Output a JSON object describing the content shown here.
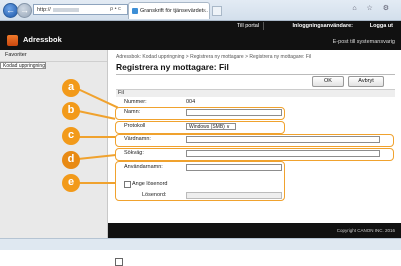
{
  "browser": {
    "address_prefix": "http://",
    "address_controls": "ρ • c",
    "tab_title": "Granskrift för tjänsevärdet...",
    "tab_close": "×",
    "window_controls": "⌂ ☆ ⚙"
  },
  "appbar": {
    "app_name": "Adressbok",
    "links": [
      "Till portal",
      "Inloggningsanvändare:",
      "Logga ut"
    ],
    "email_link": "E-post till systemansvarig"
  },
  "sidebar": {
    "items": [
      {
        "label": "Favoriter"
      },
      {
        "label": "Kodad uppringning"
      }
    ]
  },
  "main": {
    "breadcrumb": "Adressbok: Kodad uppringning > Registrera ny mottagare > Registrera ny mottagare: Fil",
    "title": "Registrera ny mottagare: Fil",
    "ok_label": "OK",
    "cancel_label": "Avbryt",
    "section": "Fil",
    "number_label": "Nummer:",
    "number_value": "004",
    "name_label": "Namn:",
    "protocol_label": "Protokoll",
    "protocol_value": "Windows (SMB) ∨",
    "host_label": "Värdnamn:",
    "path_label": "Sökväg:",
    "user_label": "Användarnamn:",
    "set_password_label": "Ange lösenord",
    "password_label": "Lösenord:"
  },
  "footer": {
    "copyright": "Copyright CANON INC. 2016"
  },
  "callouts": [
    "a",
    "b",
    "c",
    "d",
    "e"
  ],
  "colors": {
    "accent": "#f29a1a",
    "appbar": "#111111"
  }
}
